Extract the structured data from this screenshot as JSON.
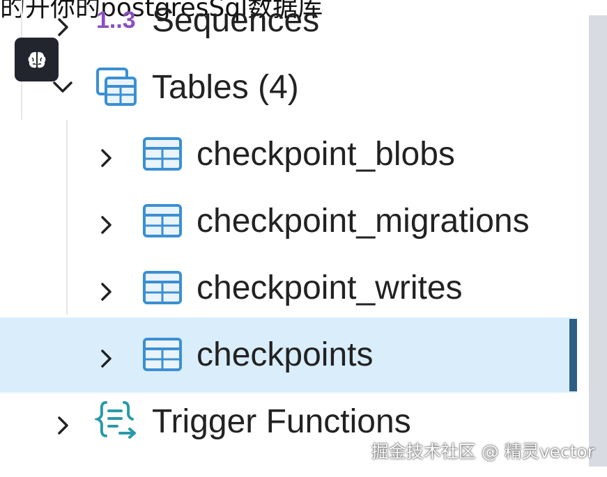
{
  "caption": "的开你的postgresSql数据库",
  "tree": {
    "sequences": {
      "label": "Sequences",
      "glyph": "1..3",
      "expanded": false,
      "icon": "sequence-icon"
    },
    "tables": {
      "label": "Tables",
      "count_text": " (4)",
      "expanded": true,
      "icon": "tables-group-icon"
    },
    "tables_children": [
      {
        "label": "checkpoint_blobs",
        "selected": false,
        "icon": "table-icon"
      },
      {
        "label": "checkpoint_migrations",
        "selected": false,
        "icon": "table-icon"
      },
      {
        "label": "checkpoint_writes",
        "selected": false,
        "icon": "table-icon"
      },
      {
        "label": "checkpoints",
        "selected": true,
        "icon": "table-icon"
      }
    ],
    "trigger_functions": {
      "label": "Trigger Functions",
      "expanded": false,
      "icon": "trigger-function-icon"
    }
  },
  "side_button": {
    "icon": "brain-icon"
  },
  "watermark": "掘金技术社区 @ 精灵vector",
  "colors": {
    "selection_bg": "#d9edfb",
    "selection_bar": "#2d5f86",
    "table_icon": "#3b8fd3",
    "sequence_glyph": "#8a4fc2",
    "trigger_icon": "#2a9aa8"
  }
}
